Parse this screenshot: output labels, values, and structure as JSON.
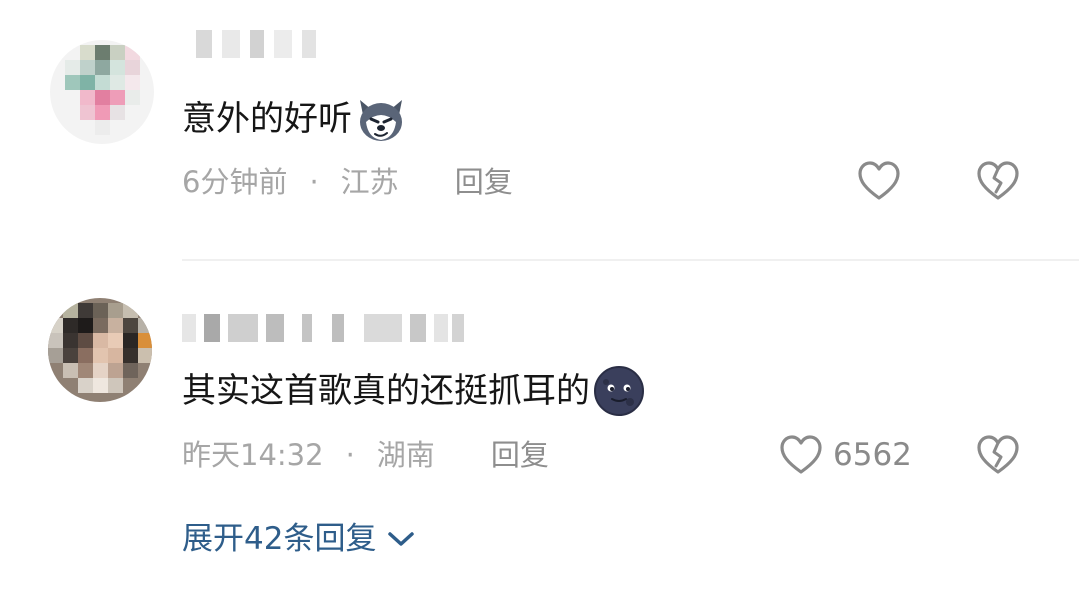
{
  "comments": [
    {
      "text": "意外的好听",
      "emoji": "husky-dog-emoji",
      "time": "6分钟前",
      "location": "江苏",
      "reply_label": "回复",
      "like_count": ""
    },
    {
      "text": "其实这首歌真的还挺抓耳的",
      "emoji": "dark-moon-face-emoji",
      "time": "昨天14:32",
      "location": "湖南",
      "reply_label": "回复",
      "like_count": "6562"
    }
  ],
  "separator": "·",
  "expand_replies": "展开42条回复",
  "icons": {
    "like": "heart-outline-icon",
    "dislike": "broken-heart-icon",
    "expand": "chevron-down-icon"
  },
  "colors": {
    "text": "#161616",
    "meta": "#a6a6a6",
    "icon": "#8a8a8a",
    "link": "#2e5d8a"
  }
}
